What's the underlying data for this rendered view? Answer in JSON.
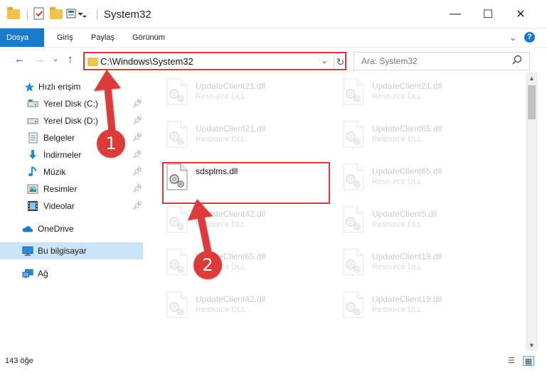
{
  "window": {
    "title": "System32",
    "minimize": "—",
    "maximize": "☐",
    "close": "✕"
  },
  "ribbon": {
    "tabs": [
      {
        "label": "Dosya",
        "active": true
      },
      {
        "label": "Giriş"
      },
      {
        "label": "Paylaş"
      },
      {
        "label": "Görünüm"
      }
    ],
    "expand_icon": "chevron-down-icon",
    "help_label": "?"
  },
  "address": {
    "path": "C:\\Windows\\System32",
    "search_placeholder": "Ara: System32"
  },
  "sidebar": {
    "items": [
      {
        "label": "Hızlı erişim",
        "icon": "star-icon",
        "pinned": false
      },
      {
        "label": "Yerel Disk (C:)",
        "icon": "drive-icon",
        "pinned": true
      },
      {
        "label": "Yerel Disk (D:)",
        "icon": "drive-icon",
        "pinned": true
      },
      {
        "label": "Belgeler",
        "icon": "documents-icon",
        "pinned": true
      },
      {
        "label": "İndirmeler",
        "icon": "download-icon",
        "pinned": true
      },
      {
        "label": "Müzik",
        "icon": "music-icon",
        "pinned": true
      },
      {
        "label": "Resimler",
        "icon": "pictures-icon",
        "pinned": true
      },
      {
        "label": "Videolar",
        "icon": "video-icon",
        "pinned": true
      },
      {
        "label": "OneDrive",
        "icon": "cloud-icon"
      },
      {
        "label": "Bu bilgisayar",
        "icon": "computer-icon",
        "selected": true
      },
      {
        "label": "Ağ",
        "icon": "network-icon"
      }
    ]
  },
  "files": {
    "left": [
      {
        "name": "UpdateClient21.dll",
        "type": "Resource DLL"
      },
      {
        "name": "UpdateClient21.dll",
        "type": "Resource DLL"
      },
      {
        "name": "sdsplms.dll",
        "type": "",
        "highlighted": true
      },
      {
        "name": "UpdateClient42.dll",
        "type": "Resource DLL"
      },
      {
        "name": "UpdateClient65.dll",
        "type": "Resource DLL"
      },
      {
        "name": "UpdateClient42.dll",
        "type": "Resource DLL"
      }
    ],
    "right": [
      {
        "name": "UpdateClient21.dll",
        "type": "Resource DLL"
      },
      {
        "name": "UpdateClient65.dll",
        "type": "Resource DLL"
      },
      {
        "name": "UpdateClient65.dll",
        "type": "Resource DLL"
      },
      {
        "name": "UpdateClient5.dll",
        "type": "Resource DLL"
      },
      {
        "name": "UpdateClient19.dll",
        "type": "Resource DLL"
      },
      {
        "name": "UpdateClient19.dll",
        "type": "Resource DLL"
      }
    ]
  },
  "status": {
    "item_count": "143 öğe"
  },
  "annotations": {
    "marker1": "1",
    "marker2": "2",
    "color": "#dd3a3a"
  },
  "colors": {
    "accent": "#1979ca",
    "highlight_border": "#d63a3a",
    "selected_nav": "#cce4f7"
  }
}
